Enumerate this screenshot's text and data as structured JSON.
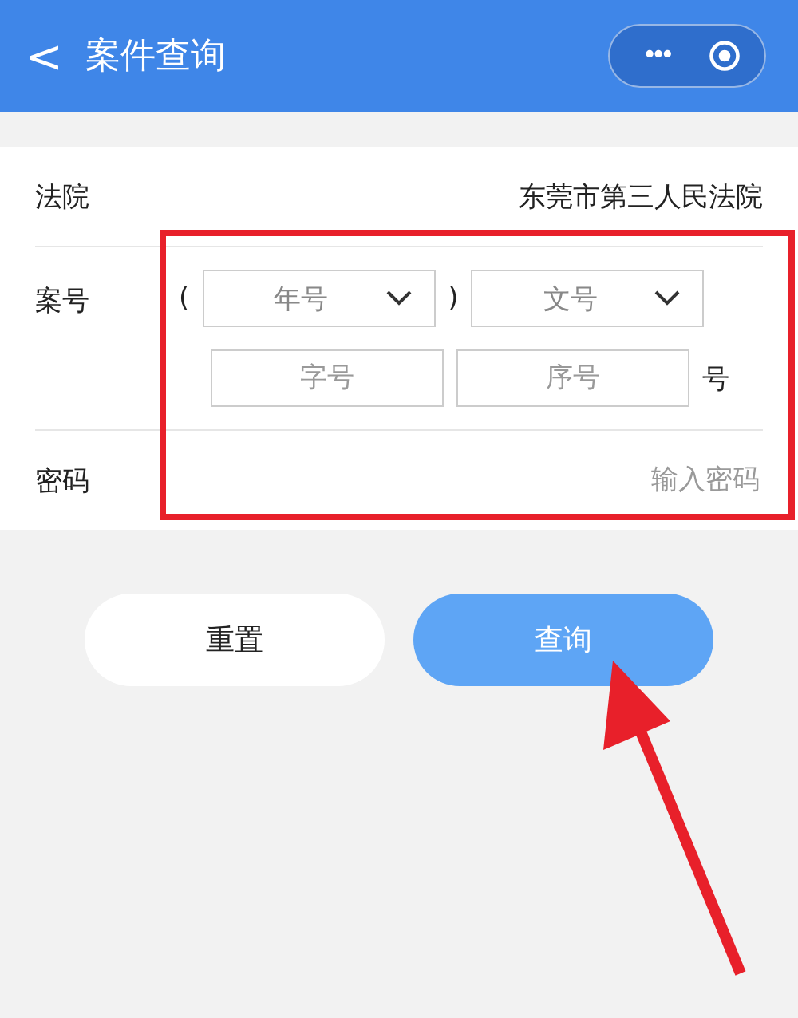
{
  "header": {
    "back": "<",
    "title": "案件查询",
    "more": "•••"
  },
  "form": {
    "court_label": "法院",
    "court_value": "东莞市第三人民法院",
    "case_label": "案号",
    "paren_open": "(",
    "paren_close": ")",
    "selects": [
      {
        "placeholder": "年号",
        "kind": "select"
      },
      {
        "placeholder": "文号",
        "kind": "select"
      }
    ],
    "inputs": [
      {
        "placeholder": "字号"
      },
      {
        "placeholder": "序号"
      }
    ],
    "suffix": "号",
    "password_label": "密码",
    "password_placeholder": "输入密码"
  },
  "buttons": [
    {
      "label": "重置",
      "kind": "secondary"
    },
    {
      "label": "查询",
      "kind": "primary"
    }
  ]
}
